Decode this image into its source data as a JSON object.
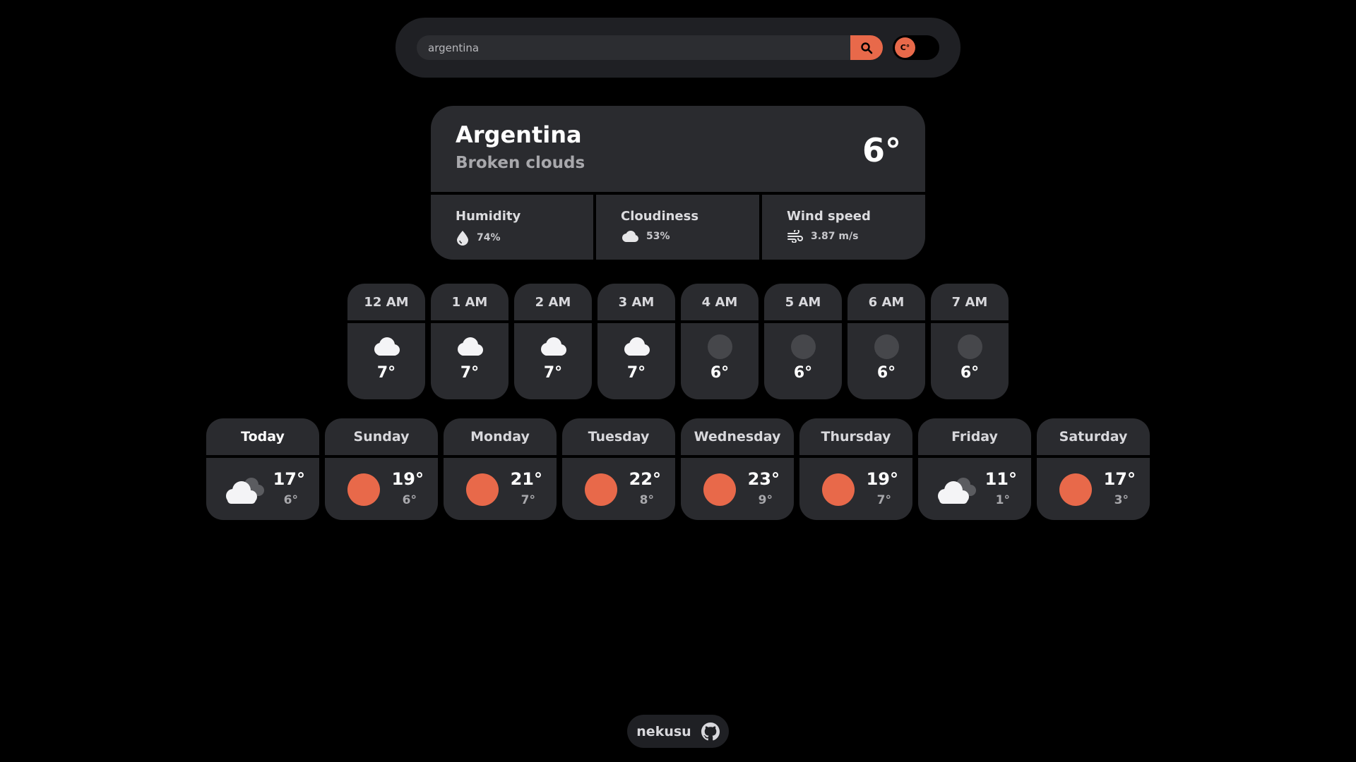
{
  "search": {
    "value": "argentina",
    "placeholder": "",
    "search_icon": "search-icon",
    "unit_label": "C°"
  },
  "current": {
    "city": "Argentina",
    "description": "Broken clouds",
    "temperature": "6°"
  },
  "stats": [
    {
      "label": "Humidity",
      "value": "74%",
      "icon": "droplet-icon"
    },
    {
      "label": "Cloudiness",
      "value": "53%",
      "icon": "cloud-icon"
    },
    {
      "label": "Wind speed",
      "value": "3.87 m/s",
      "icon": "wind-icon"
    }
  ],
  "hourly": [
    {
      "time": "12 AM",
      "temp": "7°",
      "icon": "cloud-icon"
    },
    {
      "time": "1 AM",
      "temp": "7°",
      "icon": "cloud-icon"
    },
    {
      "time": "2 AM",
      "temp": "7°",
      "icon": "cloud-icon"
    },
    {
      "time": "3 AM",
      "temp": "7°",
      "icon": "cloud-icon"
    },
    {
      "time": "4 AM",
      "temp": "6°",
      "icon": "moon-icon"
    },
    {
      "time": "5 AM",
      "temp": "6°",
      "icon": "moon-icon"
    },
    {
      "time": "6 AM",
      "temp": "6°",
      "icon": "moon-icon"
    },
    {
      "time": "7 AM",
      "temp": "6°",
      "icon": "moon-icon"
    }
  ],
  "daily": [
    {
      "day": "Today",
      "high": "17°",
      "low": "6°",
      "icon": "clouds-icon"
    },
    {
      "day": "Sunday",
      "high": "19°",
      "low": "6°",
      "icon": "sun-icon"
    },
    {
      "day": "Monday",
      "high": "21°",
      "low": "7°",
      "icon": "sun-icon"
    },
    {
      "day": "Tuesday",
      "high": "22°",
      "low": "8°",
      "icon": "sun-icon"
    },
    {
      "day": "Wednesday",
      "high": "23°",
      "low": "9°",
      "icon": "sun-icon"
    },
    {
      "day": "Thursday",
      "high": "19°",
      "low": "7°",
      "icon": "sun-icon"
    },
    {
      "day": "Friday",
      "high": "11°",
      "low": "1°",
      "icon": "clouds-icon"
    },
    {
      "day": "Saturday",
      "high": "17°",
      "low": "3°",
      "icon": "sun-icon"
    }
  ],
  "footer": {
    "label": "nekusu",
    "icon": "github-icon"
  },
  "colors": {
    "accent": "#e8694a",
    "card": "#2a2b2f",
    "background": "#000000"
  }
}
